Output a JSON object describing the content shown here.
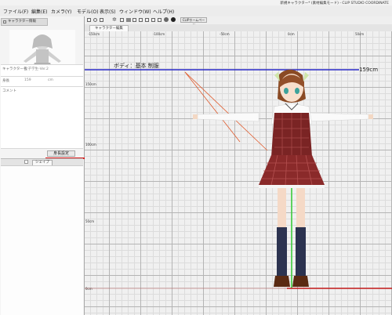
{
  "window": {
    "title": "新規キャラクター* (素材編集モード) - CLIP STUDIO COORDINATE"
  },
  "menu": [
    "ファイル(F)",
    "編集(E)",
    "カメラ(Y)",
    "モデル(O)",
    "表示(S)",
    "ウィンドウ(W)",
    "ヘルプ(H)"
  ],
  "left_panel": {
    "tab_label": "キャラクター情報",
    "properties": [
      {
        "label": "キャラクター名",
        "value": "女子学生-Ver.2"
      },
      {
        "label": "身長",
        "value": "159"
      },
      {
        "label": "コメント",
        "value": ""
      }
    ],
    "height_unit": "cm",
    "height_settings_button": "身長設定",
    "shape_tab_label": "シェイプ"
  },
  "toolbar": {
    "help_button": "CLIPホームページ"
  },
  "document": {
    "tab_label": "キャラクター編集"
  },
  "canvas": {
    "label": "ボディ：基本 制服",
    "height_readout": "159cm",
    "ruler_top": [
      "-150cm",
      "-100cm",
      "-50cm",
      "0cm",
      "50cm"
    ],
    "ruler_left": [
      "150cm",
      "100cm",
      "50cm",
      "0cm"
    ]
  },
  "colors": {
    "height_line": "#2b2bc8",
    "pointer_line": "#e05a2c",
    "red_underline": "#d81e1e",
    "floor_line": "#c41a1a",
    "center_axis": "#33cc33"
  }
}
